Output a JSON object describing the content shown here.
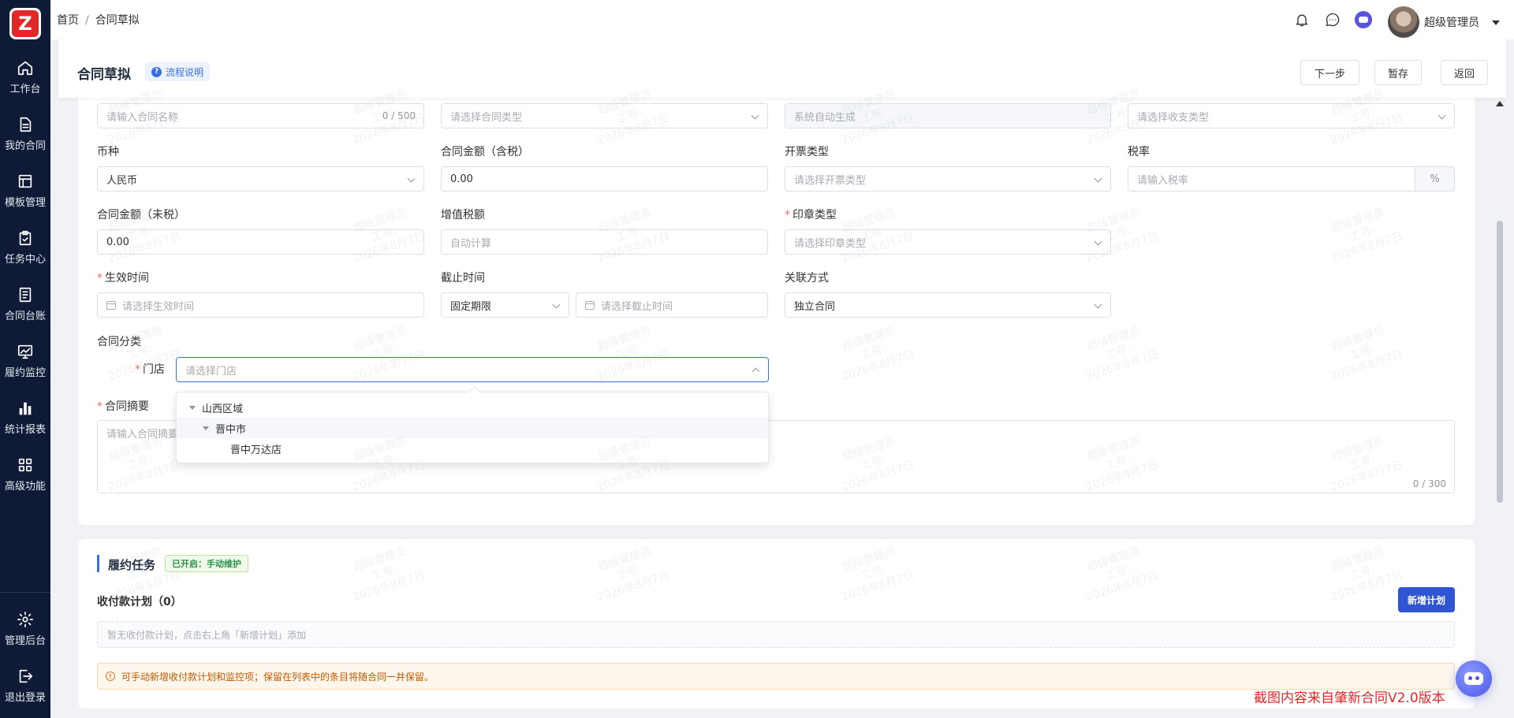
{
  "app": {
    "sidebar": {
      "items": [
        {
          "label": "工作台",
          "icon": "home-icon"
        },
        {
          "label": "我的合同",
          "icon": "document-icon"
        },
        {
          "label": "模板管理",
          "icon": "template-icon"
        },
        {
          "label": "任务中心",
          "icon": "clipboard-icon"
        },
        {
          "label": "合同台账",
          "icon": "ledger-icon"
        },
        {
          "label": "履约监控",
          "icon": "monitor-chart-icon"
        },
        {
          "label": "统计报表",
          "icon": "bar-chart-icon"
        },
        {
          "label": "高级功能",
          "icon": "grid-icon"
        }
      ],
      "bottom": [
        {
          "label": "管理后台",
          "icon": "gear-icon"
        },
        {
          "label": "退出登录",
          "icon": "logout-icon"
        }
      ]
    },
    "header": {
      "breadcrumb": [
        "首页",
        "合同草拟"
      ],
      "breadcrumb_sep": "/",
      "user_name": "超级管理员"
    },
    "titlebar": {
      "title": "合同草拟",
      "flow_tag": "流程说明",
      "buttons": {
        "next": "下一步",
        "save_draft": "暂存",
        "back": "返回"
      }
    },
    "form": {
      "contract_name": {
        "placeholder": "请输入合同名称",
        "count": "0 / 500"
      },
      "contract_type": {
        "placeholder": "请选择合同类型"
      },
      "contract_no": {
        "value": "系统自动生成"
      },
      "income_type": {
        "placeholder": "请选择收支类型"
      },
      "currency": {
        "label": "币种",
        "value": "人民币"
      },
      "amount_tax": {
        "label": "合同金额（含税）",
        "value": "0.00"
      },
      "invoice_type": {
        "label": "开票类型",
        "placeholder": "请选择开票类型"
      },
      "tax_rate": {
        "label": "税率",
        "placeholder": "请输入税率",
        "unit": "%"
      },
      "amount_notax": {
        "label": "合同金额（未税）",
        "value": "0.00"
      },
      "vat": {
        "label": "增值税额",
        "placeholder": "自动计算"
      },
      "seal_type": {
        "label": "印章类型",
        "placeholder": "请选择印章类型"
      },
      "effective_time": {
        "label": "生效时间",
        "placeholder": "请选择生效时间"
      },
      "deadline": {
        "label": "截止时间",
        "mode": "固定期限",
        "placeholder": "请选择截止时间"
      },
      "relation": {
        "label": "关联方式",
        "value": "独立合同"
      },
      "category": {
        "label": "合同分类"
      },
      "store": {
        "label": "门店",
        "placeholder": "请选择门店"
      },
      "summary": {
        "label": "合同摘要",
        "placeholder": "请输入合同摘要",
        "count": "0 / 300"
      }
    },
    "store_tree": [
      "山西区域",
      "晋中市",
      "晋中万达店"
    ],
    "fulfillment": {
      "title": "履约任务",
      "status_tag": "已开启：手动维护",
      "plan_title": "收付款计划（0）",
      "add_button": "新增计划",
      "empty_text": "暂无收付款计划，点击右上角「新增计划」添加",
      "notice": "可手动新增收付款计划和监控项；保留在列表中的条目将随合同一并保留。"
    },
    "watermark": {
      "line1": "超级管理员",
      "line2": "工号:",
      "line3": "2026年8月7日"
    },
    "footer_note": "截图内容来自肇新合同V2.0版本",
    "colors": {
      "sidebar": "#0f1b36",
      "primary": "#2f55d4",
      "danger": "#e02828",
      "success": "#2b9348"
    }
  }
}
